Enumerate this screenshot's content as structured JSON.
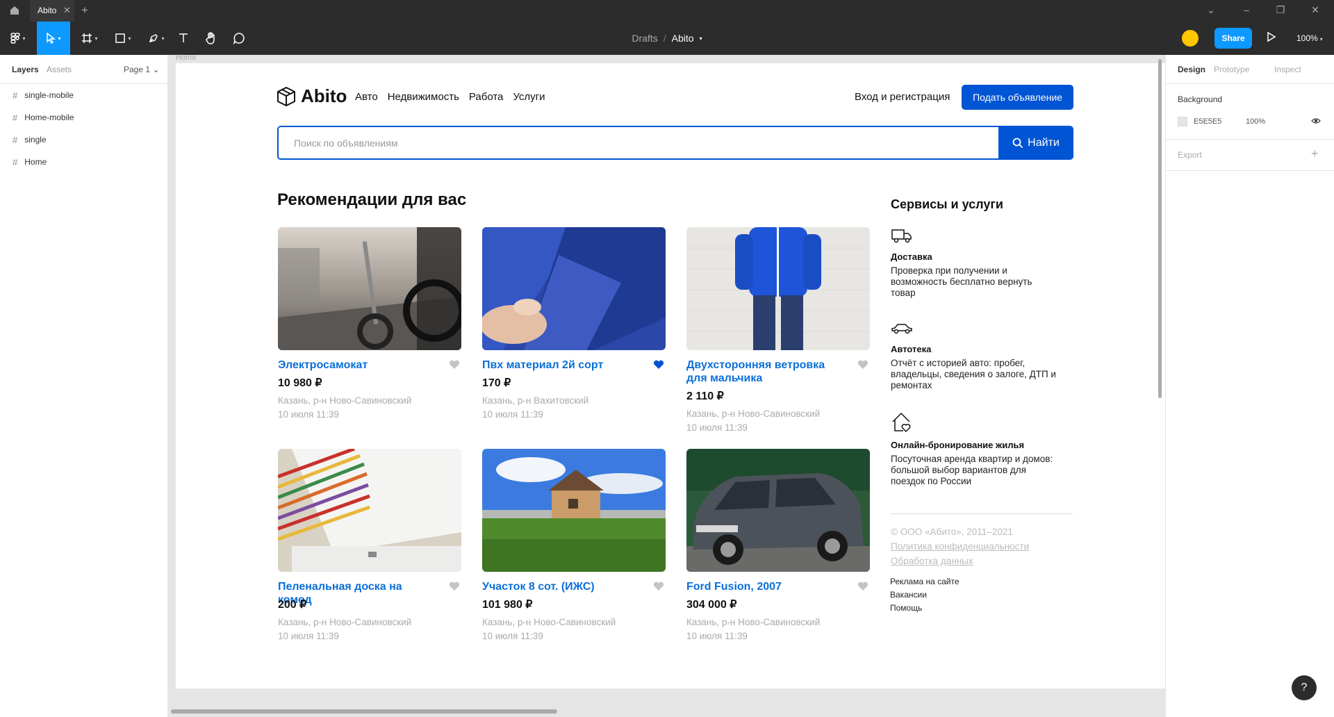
{
  "titlebar": {
    "tab_title": "Abito",
    "tab_close": "✕",
    "new_tab": "+",
    "window_controls": [
      "⌄",
      "–",
      "❐",
      "✕"
    ]
  },
  "toolbar": {
    "breadcrumb_parent": "Drafts",
    "breadcrumb_sep": "/",
    "file_name": "Abito",
    "share_label": "Share",
    "zoom": "100%",
    "tools": [
      "figma-menu-icon",
      "move-icon",
      "frame-icon",
      "rectangle-icon",
      "pen-icon",
      "text-icon",
      "hand-icon",
      "comment-icon"
    ]
  },
  "left_panel": {
    "tab_layers": "Layers",
    "tab_assets": "Assets",
    "page": "Page 1 ⌄",
    "layers": [
      {
        "label": "single-mobile"
      },
      {
        "label": "Home-mobile"
      },
      {
        "label": "single"
      },
      {
        "label": "Home"
      }
    ]
  },
  "right_panel": {
    "tab_design": "Design",
    "tab_prototype": "Prototype",
    "tab_inspect": "Inspect",
    "background_label": "Background",
    "background_hex": "E5E5E5",
    "background_opacity": "100%",
    "export_label": "Export",
    "export_add": "+"
  },
  "frame": {
    "label": "Home",
    "logo_text": "Abito",
    "nav": [
      "Авто",
      "Недвижимость",
      "Работа",
      "Услуги"
    ],
    "login": "Вход и регистрация",
    "post_button": "Подать объявление",
    "search_placeholder": "Поиск по объявлениям",
    "search_button": "Найти",
    "rec_title": "Рекомендации для вас",
    "cards": [
      {
        "title": "Электросамокат",
        "price": "10 980 ₽",
        "location": "Казань, р-н Ново-Савиновский",
        "date": "10 июля 11:39",
        "favorite": false
      },
      {
        "title": "Пвх материал 2й сорт",
        "price": "170 ₽",
        "location": "Казань, р-н Вахитовский",
        "date": "10 июля 11:39",
        "favorite": true
      },
      {
        "title": "Двухсторонняя ветровка для мальчика",
        "price": "2 110 ₽",
        "location": "Казань, р-н Ново-Савиновский",
        "date": "10 июля 11:39",
        "favorite": false
      },
      {
        "title": "Пеленальная доска на комод",
        "price": "200 ₽",
        "location": "Казань, р-н Ново-Савиновский",
        "date": "10 июля 11:39",
        "favorite": false
      },
      {
        "title": "Участок 8 сот. (ИЖС)",
        "price": "101 980 ₽",
        "location": "Казань, р-н Ново-Савиновский",
        "date": "10 июля 11:39",
        "favorite": false
      },
      {
        "title": "Ford Fusion, 2007",
        "price": "304 000 ₽",
        "location": "Казань, р-н Ново-Савиновский",
        "date": "10 июля 11:39",
        "favorite": false
      }
    ],
    "services_title": "Сервисы и услуги",
    "services": [
      {
        "icon": "truck-icon",
        "title": "Доставка",
        "desc": "Проверка при получении и возможность бесплатно вернуть товар"
      },
      {
        "icon": "car-icon",
        "title": "Автотека",
        "desc": "Отчёт с историей авто: пробег, владельцы, сведения о залоге, ДТП и ремонтах"
      },
      {
        "icon": "house-heart-icon",
        "title": "Онлайн-бронирование жилья",
        "desc": "Посуточная аренда квартир и домов: большой выбор вариантов для поездок по России"
      }
    ],
    "copyright": "© ООО «Абито», 2011–2021",
    "privacy": "Политика конфиденциальности",
    "data_processing": "Обработка данных",
    "footer_links": [
      "Реклама на сайте",
      "Вакансии",
      "Помощь"
    ]
  },
  "help": "?",
  "colors": {
    "accent": "#0d99ff",
    "brand_blue": "#0055d4",
    "link_blue": "#0a6fd8",
    "heart_active": "#0055d4",
    "heart_inactive": "#c4c4c4"
  }
}
